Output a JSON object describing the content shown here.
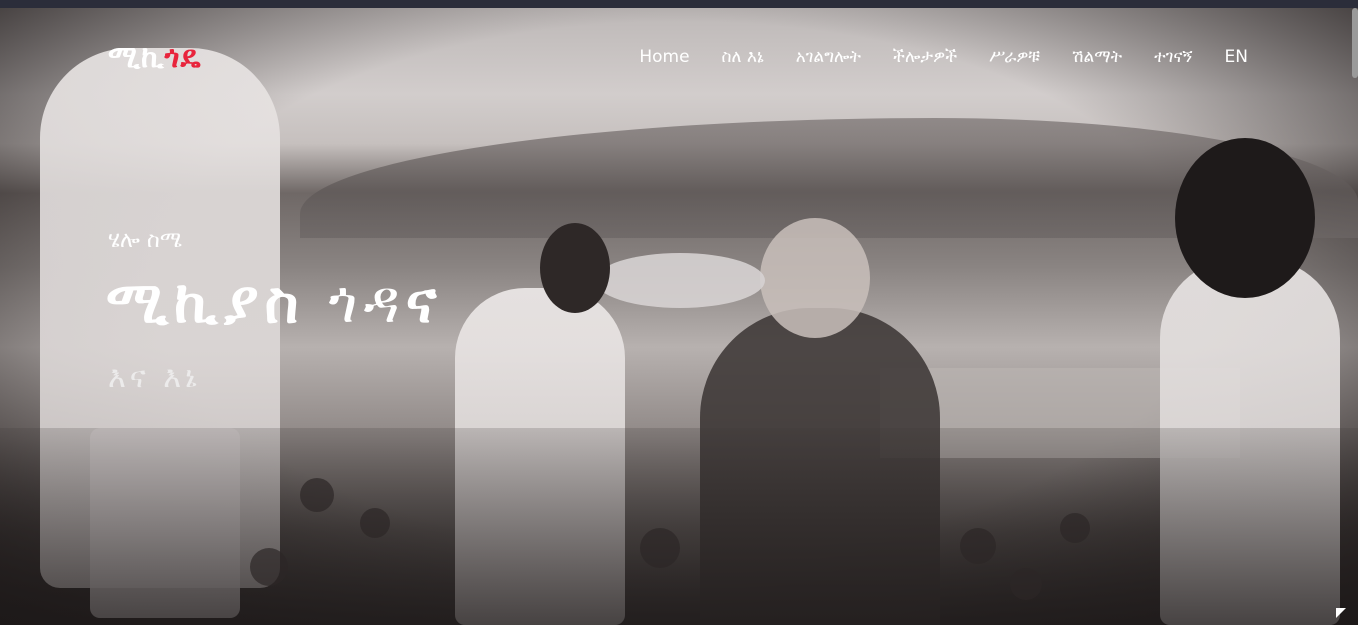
{
  "brand": {
    "part1": "ሚኪ",
    "part2": "ጎዴ",
    "accent_color": "#e8243c"
  },
  "nav": {
    "items": [
      {
        "label": "Home"
      },
      {
        "label": "ስለ እኔ"
      },
      {
        "label": "አገልግሎት"
      },
      {
        "label": "ችሎታዎች"
      },
      {
        "label": "ሥራዎቹ"
      },
      {
        "label": "ሽልማት"
      },
      {
        "label": "ተገናኝ"
      },
      {
        "label": "EN"
      }
    ]
  },
  "hero": {
    "greeting": "ሄሎ ስሜ",
    "name_first": "ሚኪያስ",
    "name_last_light": "ጎዳ",
    "name_last_bold": "ና",
    "role": "እና እኔ"
  }
}
